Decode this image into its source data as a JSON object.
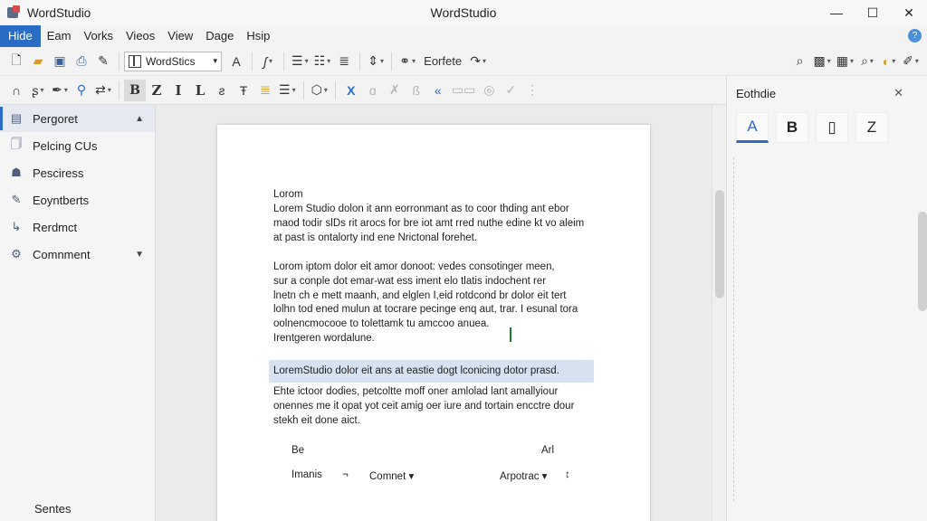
{
  "app": {
    "name": "WordStudio",
    "window_title": "WordStudio",
    "controls": {
      "minimize": "—",
      "maximize": "☐",
      "close": "✕"
    }
  },
  "menu": {
    "items": [
      "Hide",
      "Eam",
      "Vorks",
      "Vieos",
      "View",
      "Dage",
      "Hsip"
    ],
    "help": "?"
  },
  "toolbar1": {
    "font_name": "WordStics",
    "font_size_icon": "A",
    "style_label": "Eorfete"
  },
  "toolbar2": {
    "bold": "B",
    "italic": "Z",
    "i": "I",
    "l": "L",
    "x": "X"
  },
  "sidebar": {
    "items": [
      {
        "label": "Pergoret",
        "icon": "grid-icon",
        "caret": "▲"
      },
      {
        "label": "Pelcing CUs",
        "icon": "doc-icon"
      },
      {
        "label": "Pesciress",
        "icon": "person-icon"
      },
      {
        "label": "Eoyntberts",
        "icon": "wrench-icon"
      },
      {
        "label": "Rerdmct",
        "icon": "arrow-icon"
      },
      {
        "label": "Comnment",
        "icon": "gear-icon",
        "caret": "▼"
      }
    ],
    "footer": "Sentes"
  },
  "document": {
    "heading": "Lorom",
    "paragraph1": [
      "Lorem Studio dolon it ann eorronmant as to coor thding ant ebor",
      "maod todir slDs rit arocs for bre iot amt rred nuthe edine kt vo aleim",
      "at past is ontalorty ind ene Nrictonal forehet."
    ],
    "paragraph2": [
      "Lorom iptom dolor eit amor donoot: vedes consotinger meen,",
      "sur a conple dot emar-wat ess iment elo tlatis indochent rer",
      "lnetn ch e mett maanh, and elglen I,eid rotdcond br dolor eit tert",
      "lolhn tod ened mulun at tocrare pecinge enq aut, trar. I esunal tora",
      "oolnencmocooe to tolettamk tu amccoo anuea.",
      "Irentgeren wordalune."
    ],
    "highlighted_line": "LoremStudio dolor eit ans at eastie dogt lconicing dotor prasd.",
    "paragraph3": [
      "Ehte ictoor dodies, petcoltte moff oner amlolad lant amallyiour",
      "onennes me it opat yot ceit amig oer iure and tortain encctre dour",
      "stekh eit done aict."
    ],
    "row1": {
      "left": "Be",
      "right": "Arl"
    },
    "row2": {
      "a": "Imanis",
      "b": "¬",
      "c": "Comnet ▾",
      "d": "Arpotrac ▾",
      "e": "↕"
    }
  },
  "panel": {
    "title": "Eothdie",
    "close": "✕",
    "tabs": [
      "A",
      "B",
      "▯",
      "Z"
    ]
  }
}
